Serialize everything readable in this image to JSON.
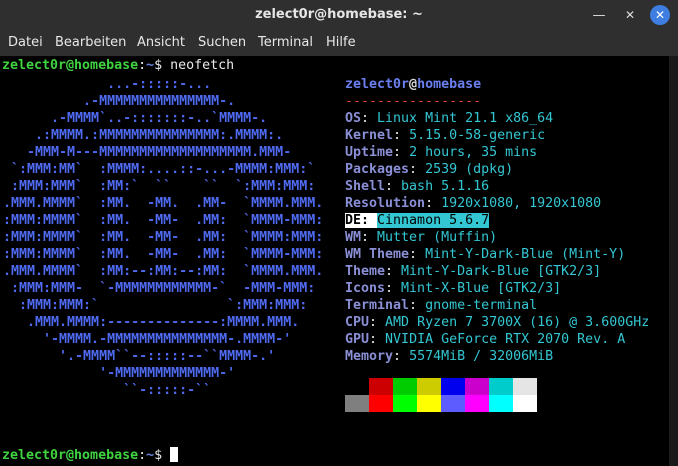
{
  "window": {
    "title": "zelect0r@homebase: ~",
    "min_icon": "minimize-icon",
    "max_icon": "maximize-icon",
    "close_icon": "close-icon"
  },
  "menu": [
    "Datei",
    "Bearbeiten",
    "Ansicht",
    "Suchen",
    "Terminal",
    "Hilfe"
  ],
  "prompt": {
    "user_host": "zelect0r@homebase",
    "colon": ":",
    "path": "~",
    "symbol": "$ ",
    "command": "neofetch"
  },
  "logo": [
    "             ...-:::::-...",
    "          .-MMMMMMMMMMMMMMM-.",
    "      .-MMMM`..-:::::::-..`MMMM-.",
    "    .:MMMM.:MMMMMMMMMMMMMMM:.MMMM:.",
    "   -MMM-M---MMMMMMMMMMMMMMMMMMM.MMM-",
    " `:MMM:MM`  :MMMM:....::-...-MMMM:MMM:`",
    " :MMM:MMM`  :MM:`  ``    ``  `:MMM:MMM:",
    ".MMM.MMMM`  :MM.  -MM.  .MM-  `MMMM.MMM.",
    ":MMM:MMMM`  :MM.  -MM-  .MM:  `MMMM-MMM:",
    ":MMM:MMMM`  :MM.  -MM-  .MM:  `MMMM:MMM:",
    ":MMM:MMMM`  :MM.  -MM-  .MM:  `MMMM-MMM:",
    ".MMM.MMMM`  :MM:--:MM:--:MM:  `MMMM.MMM.",
    " :MMM:MMM-  `-MMMMMMMMMMMM-`  -MMM-MMM:",
    "  :MMM:MMM:`                `:MMM:MMM:",
    "   .MMM.MMMM:--------------:MMMM.MMM.",
    "     '-MMMM.-MMMMMMMMMMMMMMM-.MMMM-'",
    "       '.-MMMM``--:::::--``MMMM-.'",
    "            '-MMMMMMMMMMMMM-'",
    "               ``-:::::-``"
  ],
  "info": {
    "user": "zelect0r",
    "at": "@",
    "host": "homebase",
    "separator": "-----------------",
    "rows": [
      {
        "key": "OS",
        "value": "Linux Mint 21.1 x86_64"
      },
      {
        "key": "Kernel",
        "value": "5.15.0-58-generic"
      },
      {
        "key": "Uptime",
        "value": "2 hours, 35 mins"
      },
      {
        "key": "Packages",
        "value": "2539 (dpkg)"
      },
      {
        "key": "Shell",
        "value": "bash 5.1.16"
      },
      {
        "key": "Resolution",
        "value": "1920x1080, 1920x1080"
      },
      {
        "key": "DE",
        "value": "Cinnamon 5.6.7"
      },
      {
        "key": "WM",
        "value": "Mutter (Muffin)"
      },
      {
        "key": "WM Theme",
        "value": "Mint-Y-Dark-Blue (Mint-Y)"
      },
      {
        "key": "Theme",
        "value": "Mint-Y-Dark-Blue [GTK2/3]"
      },
      {
        "key": "Icons",
        "value": "Mint-X-Blue [GTK2/3]"
      },
      {
        "key": "Terminal",
        "value": "gnome-terminal"
      },
      {
        "key": "CPU",
        "value": "AMD Ryzen 7 3700X (16) @ 3.600GHz"
      },
      {
        "key": "GPU",
        "value": "NVIDIA GeForce RTX 2070 Rev. A"
      },
      {
        "key": "Memory",
        "value": "5574MiB / 32006MiB"
      }
    ],
    "colon": ": "
  },
  "palette": {
    "top": [
      "#000000",
      "#cc0000",
      "#00cc00",
      "#cccc00",
      "#0000ee",
      "#cc00cc",
      "#00cccc",
      "#e5e5e5"
    ],
    "bottom": [
      "#7f7f7f",
      "#ff0000",
      "#00ff00",
      "#ffff00",
      "#5c5cff",
      "#ff00ff",
      "#00ffff",
      "#ffffff"
    ]
  }
}
